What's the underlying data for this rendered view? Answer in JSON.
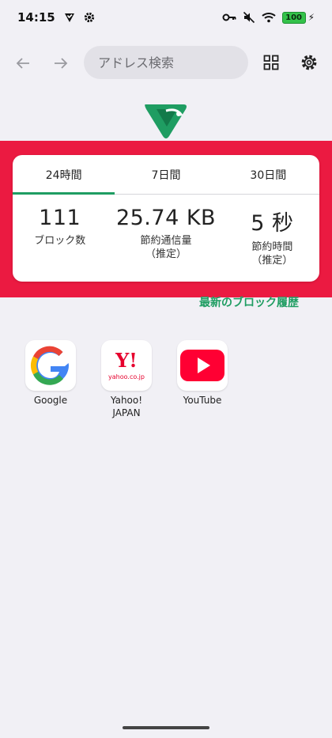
{
  "status_bar": {
    "time": "14:15",
    "battery": "100",
    "icons_left": [
      "shield-check-icon",
      "gear-icon"
    ],
    "icons_right": [
      "key-icon",
      "mute-icon",
      "wifi-icon",
      "battery-icon"
    ]
  },
  "toolbar": {
    "address_placeholder": "アドレス検索",
    "icons": [
      "back-arrow-icon",
      "forward-arrow-icon",
      "grid-icon",
      "settings-icon"
    ]
  },
  "stats": {
    "tabs": [
      {
        "label": "24時間",
        "active": true
      },
      {
        "label": "7日間",
        "active": false
      },
      {
        "label": "30日間",
        "active": false
      }
    ],
    "items": [
      {
        "value": "111",
        "label": "ブロック数"
      },
      {
        "value": "25.74 KB",
        "label": "節約通信量\n（推定）"
      },
      {
        "value": "5 秒",
        "label": "節約時間\n（推定）"
      }
    ],
    "recent_link": "最新のブロック履歴"
  },
  "shortcuts": [
    {
      "label": "Google"
    },
    {
      "label": "Yahoo!\nJAPAN",
      "icon_text": "Y!",
      "icon_subtext": "yahoo.co.jp"
    },
    {
      "label": "YouTube"
    }
  ],
  "colors": {
    "accent": "#1f9d62",
    "highlight": "#eb1a41",
    "background": "#f1f0f5"
  }
}
